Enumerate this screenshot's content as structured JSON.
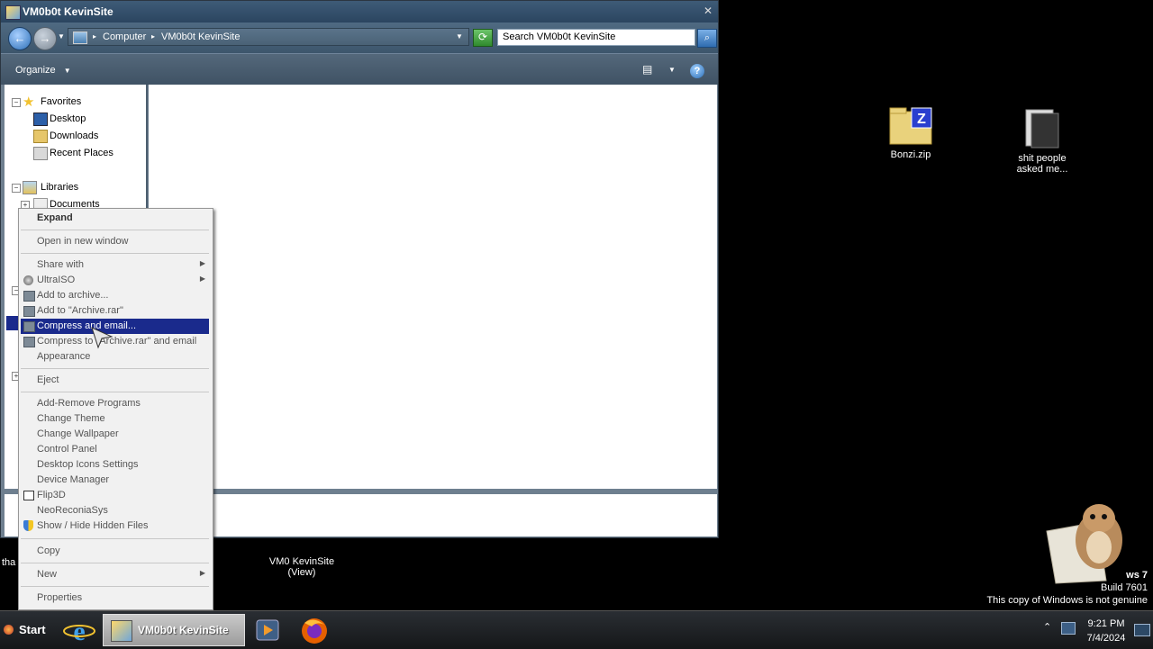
{
  "window": {
    "title": "VM0b0t KevinSite",
    "breadcrumb": [
      "Computer",
      "VM0b0t KevinSite"
    ],
    "search_placeholder": "Search VM0b0t KevinSite",
    "toolbar_organize": "Organize"
  },
  "navpane": {
    "favorites": "Favorites",
    "desktop": "Desktop",
    "downloads": "Downloads",
    "recent_places": "Recent Places",
    "libraries": "Libraries",
    "documents": "Documents"
  },
  "context_menu": {
    "expand": "Expand",
    "open_new_window": "Open in new window",
    "share_with": "Share with",
    "ultraiso": "UltraISO",
    "add_to_archive": "Add to archive...",
    "add_to_archive_rar": "Add to \"Archive.rar\"",
    "compress_email": "Compress and email...",
    "compress_rar_email": "Compress to \"Archive.rar\" and email",
    "appearance": "Appearance",
    "eject": "Eject",
    "add_remove": "Add-Remove Programs",
    "change_theme": "Change Theme",
    "change_wallpaper": "Change Wallpaper",
    "control_panel": "Control Panel",
    "desktop_icons": "Desktop Icons Settings",
    "device_manager": "Device Manager",
    "flip3d": "Flip3D",
    "neoreconiasys": "NeoReconiaSys",
    "show_hide": "Show / Hide Hidden Files",
    "copy": "Copy",
    "new": "New",
    "properties": "Properties"
  },
  "desktop": {
    "bonzi_label": "Bonzi.zip",
    "folder_label_1": "shit people",
    "folder_label_2": "asked me...",
    "vm_label_1": "VM0 KevinSite",
    "vm_label_2": "(View)",
    "partial_label": "tha"
  },
  "watermark": {
    "line1": "ws 7",
    "line2": "Build 7601",
    "line3": "This copy of Windows is not genuine"
  },
  "taskbar": {
    "start": "Start",
    "active_window": "VM0b0t KevinSite",
    "time": "9:21 PM",
    "date": "7/4/2024"
  }
}
